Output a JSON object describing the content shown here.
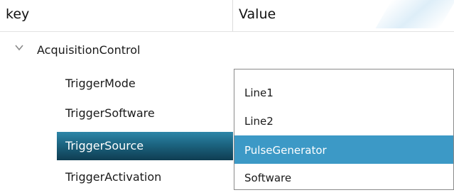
{
  "header": {
    "key_label": "key",
    "value_label": "Value"
  },
  "group": {
    "label": "AcquisitionControl"
  },
  "properties": [
    {
      "label": "TriggerMode"
    },
    {
      "label": "TriggerSoftware"
    },
    {
      "label": "TriggerSource"
    },
    {
      "label": "TriggerActivation"
    }
  ],
  "selected_property": "TriggerSource",
  "dropdown": {
    "options": [
      "Line1",
      "Line2",
      "PulseGenerator",
      "Software"
    ],
    "highlighted": "PulseGenerator"
  },
  "colors": {
    "selection_accent": "#1c6480",
    "dropdown_highlight": "#3c99c6"
  },
  "icons": {
    "group_toggle": "chevron-down-icon"
  }
}
